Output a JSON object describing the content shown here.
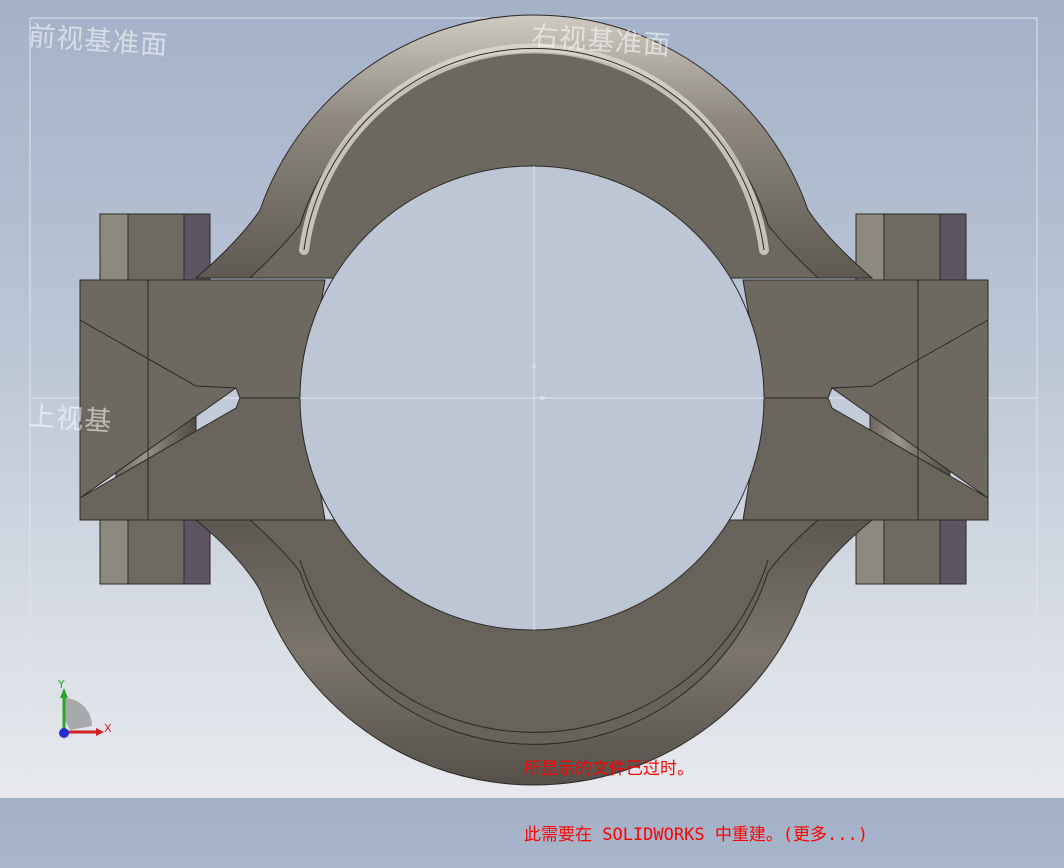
{
  "planes": {
    "front": "前视基准面",
    "right": "右视基准面",
    "top": "上视基"
  },
  "triad": {
    "x_label": "X",
    "y_label": "Y"
  },
  "notice": {
    "line1": "所显示的文件已过时。",
    "line2": "此需要在 SOLIDWORKS 中重建。(更多...)"
  },
  "colors": {
    "notice": "#ff0000",
    "part_face": "#6e6960",
    "x_axis": "#d42020",
    "y_axis": "#2aa32a",
    "z_axis": "#2030d0"
  }
}
